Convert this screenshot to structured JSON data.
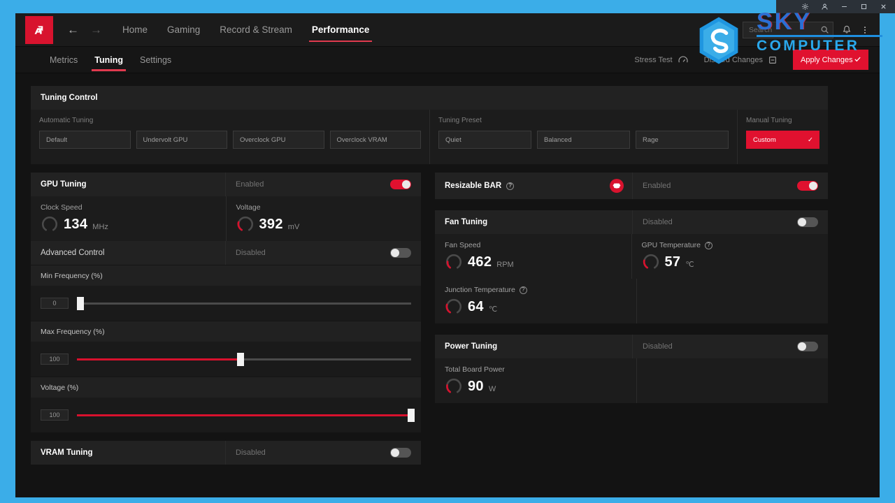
{
  "window": {
    "caption_buttons": [
      {
        "name": "settings-icon",
        "glyph": "gear"
      },
      {
        "name": "user-icon",
        "glyph": "user"
      },
      {
        "name": "minimize-icon",
        "glyph": "minimize"
      },
      {
        "name": "maximize-icon",
        "glyph": "maximize"
      },
      {
        "name": "close-icon",
        "glyph": "close"
      }
    ]
  },
  "topbar": {
    "logo_alt": "AMD Radeon Software",
    "back_arrow": "←",
    "forward_arrow": "→",
    "nav": [
      {
        "label": "Home",
        "active": false
      },
      {
        "label": "Gaming",
        "active": false
      },
      {
        "label": "Record & Stream",
        "active": false
      },
      {
        "label": "Performance",
        "active": true
      }
    ],
    "search": {
      "placeholder": "Search",
      "value": ""
    },
    "notifications_icon": "bell-icon",
    "overflow_icon": "more-icon"
  },
  "subnav": {
    "tabs": [
      {
        "label": "Metrics",
        "active": false
      },
      {
        "label": "Tuning",
        "active": true
      },
      {
        "label": "Settings",
        "active": false
      }
    ],
    "stress_test": "Stress Test",
    "discard_changes": "Discard Changes",
    "apply_changes": "Apply Changes"
  },
  "tuning_control": {
    "title": "Tuning Control",
    "automatic": {
      "label": "Automatic Tuning",
      "buttons": [
        "Default",
        "Undervolt GPU",
        "Overclock GPU",
        "Overclock VRAM"
      ]
    },
    "preset": {
      "label": "Tuning Preset",
      "buttons": [
        "Quiet",
        "Balanced",
        "Rage"
      ]
    },
    "manual": {
      "label": "Manual Tuning",
      "button": "Custom",
      "selected": true,
      "check": "✓"
    }
  },
  "gpu_tuning": {
    "title": "GPU Tuning",
    "state": "Enabled",
    "enabled": true,
    "clock_speed": {
      "label": "Clock Speed",
      "value": "134",
      "unit": "MHz",
      "gauge_pct": 0
    },
    "voltage": {
      "label": "Voltage",
      "value": "392",
      "unit": "mV",
      "gauge_pct": 35
    },
    "advanced_control": {
      "label": "Advanced Control",
      "state": "Disabled",
      "enabled": false
    },
    "sliders": [
      {
        "label": "Min Frequency (%)",
        "value": "0",
        "pct": 0
      },
      {
        "label": "Max Frequency (%)",
        "value": "100",
        "pct": 49
      },
      {
        "label": "Voltage (%)",
        "value": "100",
        "pct": 100
      }
    ]
  },
  "vram_tuning": {
    "title": "VRAM Tuning",
    "state": "Disabled",
    "enabled": false
  },
  "resizable_bar": {
    "title": "Resizable BAR",
    "info": "?",
    "badge_icon": "brain-icon",
    "state": "Enabled",
    "enabled": true
  },
  "fan_tuning": {
    "title": "Fan Tuning",
    "state": "Disabled",
    "enabled": false,
    "fan_speed": {
      "label": "Fan Speed",
      "value": "462",
      "unit": "RPM",
      "gauge_pct": 22
    },
    "gpu_temperature": {
      "label": "GPU Temperature",
      "info": "?",
      "value": "57",
      "unit": "℃",
      "gauge_pct": 30
    },
    "junction_temperature": {
      "label": "Junction Temperature",
      "info": "?",
      "value": "64",
      "unit": "℃",
      "gauge_pct": 34
    }
  },
  "power_tuning": {
    "title": "Power Tuning",
    "state": "Disabled",
    "enabled": false,
    "total_board_power": {
      "label": "Total Board Power",
      "value": "90",
      "unit": "W",
      "gauge_pct": 28
    }
  },
  "watermark": {
    "line1": "SKY",
    "line2": "COMPUTER"
  },
  "colors": {
    "accent_red": "#e0112f",
    "amd_red": "#d8132e",
    "border_cyan": "#3bade8",
    "panel": "#1e1e1e"
  }
}
